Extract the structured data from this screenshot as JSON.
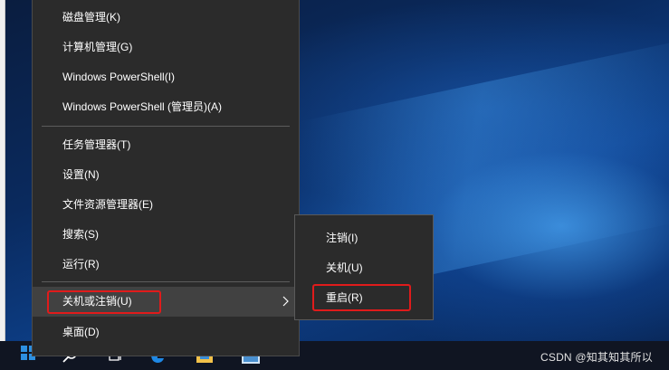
{
  "main_menu": {
    "items": [
      {
        "label": "磁盘管理(K)"
      },
      {
        "label": "计算机管理(G)"
      },
      {
        "label": "Windows PowerShell(I)"
      },
      {
        "label": "Windows PowerShell (管理员)(A)"
      },
      {
        "label": "任务管理器(T)"
      },
      {
        "label": "设置(N)"
      },
      {
        "label": "文件资源管理器(E)"
      },
      {
        "label": "搜索(S)"
      },
      {
        "label": "运行(R)"
      },
      {
        "label": "关机或注销(U)"
      },
      {
        "label": "桌面(D)"
      }
    ],
    "highlighted_item": "关机或注销(U)"
  },
  "sub_menu": {
    "items": [
      {
        "label": "注销(I)"
      },
      {
        "label": "关机(U)"
      },
      {
        "label": "重启(R)"
      }
    ]
  },
  "annotations": {
    "highlight_color": "#e01b1b"
  },
  "watermark": "CSDN @知其知其所以",
  "colors": {
    "menu_bg": "#2b2b2b",
    "menu_highlight": "#414141",
    "menu_text": "#ffffff",
    "desktop_blue": "#0d3e86",
    "windows_accent": "#2d8fe0"
  },
  "icons": [
    "windows-start-icon",
    "search-icon",
    "task-view-icon",
    "edge-icon",
    "file-explorer-icon",
    "store-icon",
    "submenu-arrow-icon"
  ]
}
